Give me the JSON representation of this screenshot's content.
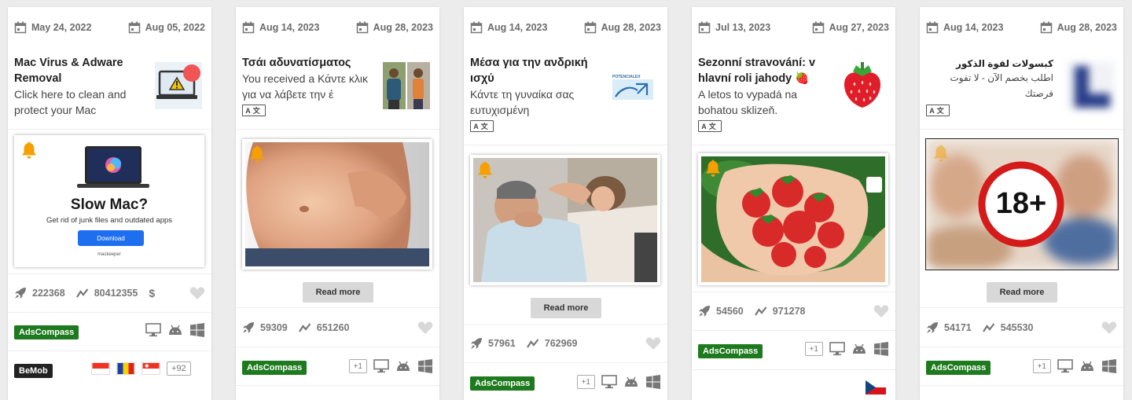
{
  "cards": [
    {
      "date_start": "May 24, 2022",
      "date_end": "Aug 05, 2022",
      "title": "Mac Virus & Adware Removal",
      "description": "Click here to clean and protect your Mac",
      "banner": {
        "headline": "Slow Mac?",
        "subtext": "Get rid of junk files and outdated apps",
        "button": "Download",
        "brand": "mackeeper"
      },
      "stats": {
        "impressions": "222368",
        "trend": "80412355",
        "currency": "$"
      },
      "network": "AdsCompass",
      "tracker": "BeMob",
      "extra_geos": "+92"
    },
    {
      "date_start": "Aug 14, 2023",
      "date_end": "Aug 28, 2023",
      "title": "Τσάι αδυνατίσματος",
      "description": "You received a Κάντε κλικ για να λάβετε την έ",
      "translate_label": "A文",
      "read_more": "Read more",
      "stats": {
        "impressions": "59309",
        "trend": "651260"
      },
      "network": "AdsCompass",
      "extra_badge": "+1"
    },
    {
      "date_start": "Aug 14, 2023",
      "date_end": "Aug 28, 2023",
      "title": "Μέσα για την ανδρική ισχύ",
      "description": "Κάντε τη γυναίκα σας ευτυχισμένη",
      "translate_label": "A文",
      "thumb_brand": "POTENCIALEX",
      "read_more": "Read more",
      "stats": {
        "impressions": "57961",
        "trend": "762969"
      },
      "network": "AdsCompass",
      "extra_badge": "+1"
    },
    {
      "date_start": "Jul 13, 2023",
      "date_end": "Aug 27, 2023",
      "title": "Sezonní stravování: v hlavní roli jahody 🍓",
      "description": "A letos to vypadá na bohatou sklizeň.",
      "translate_label": "A文",
      "stats": {
        "impressions": "54560",
        "trend": "971278"
      },
      "network": "AdsCompass",
      "extra_badge": "+1"
    },
    {
      "date_start": "Aug 14, 2023",
      "date_end": "Aug 28, 2023",
      "title": "كبسولات لقوة الذكور",
      "description": "اطلب بخصم الآن - لا تفوت فرصتك",
      "translate_label": "A文",
      "overlay": "18+",
      "read_more": "Read more",
      "stats": {
        "impressions": "54171",
        "trend": "545530"
      },
      "network": "AdsCompass",
      "extra_badge": "+1"
    }
  ],
  "colors": {
    "network_badge": "#1e7a1e",
    "bell": "#f5a000",
    "card_bg": "#ffffff",
    "page_bg": "#ececec"
  },
  "icons": [
    "calendar-icon",
    "rocket-icon",
    "trend-icon",
    "heart-icon",
    "bell-icon",
    "desktop-icon",
    "android-icon",
    "windows-icon"
  ]
}
